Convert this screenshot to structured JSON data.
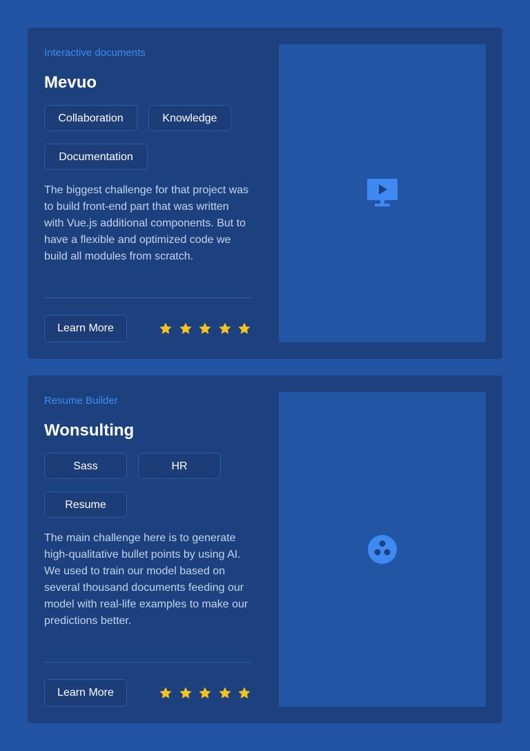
{
  "projects": [
    {
      "category": "Interactive documents",
      "title": "Mevuo",
      "tags": [
        "Collaboration",
        "Knowledge",
        "Documentation"
      ],
      "description": "The biggest challenge for that project was to build front-end part that was written with Vue.js additional components. But to have a flexible and optimized code we build all modules from scratch.",
      "button_label": "Learn More",
      "rating": 5,
      "rating_max": 5,
      "media_icon": "monitor-play-icon"
    },
    {
      "category": "Resume Builder",
      "title": "Wonsulting",
      "tags": [
        "Sass",
        "HR",
        "Resume"
      ],
      "description": "The main challenge here is to generate high-qualitative bullet points by using AI. We used to train our model based on several thousand documents feeding our model with real-life examples to make our predictions better.",
      "button_label": "Learn More",
      "rating": 5,
      "rating_max": 5,
      "media_icon": "three-dots-circle-icon"
    }
  ],
  "colors": {
    "page_background": "#2354a3",
    "card_background": "#1d417f",
    "media_background": "#2355a5",
    "accent": "#3d8bf2",
    "star": "#f6c31c",
    "description_text": "#c4d3ec"
  }
}
